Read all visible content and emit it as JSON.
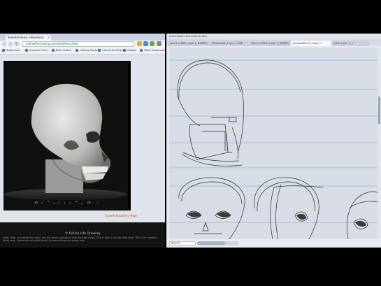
{
  "browser": {
    "tab_title": "Skeletal Head, eSkeletons",
    "address": "onlinelifedrawing.com/skull/skull.html",
    "bookmarks": [
      "Bookmarks",
      "Imported from...",
      "Most Visited",
      "Getting Started",
      "Latest Headlines",
      "Google",
      "Other bookmarks"
    ],
    "credit_link": "FaceAndAnatomy Page",
    "page_title": "© Online Life Drawing",
    "description": "Grab, drag, and rotate the skull. Use the arrow controls to step through views. This is free to use for reference. This is for personal study only, please do not redistribute. For educational purposes only."
  },
  "app": {
    "title": "sketchbook-skull-head-studies",
    "tabs": [
      "skull 1 (100%, Layer 1, RGB/8*)",
      "Sketchbook, Layer 1, RGB",
      "head 2 (100%, Layer 1, RGB/8*)",
      "skull-profile-14, Layer 1",
      "(50%, Layer 1...)"
    ],
    "active_tab_index": 3,
    "zoom": "66.67%"
  },
  "colors": {
    "guide_blue": "#8fb4dc",
    "credit_red": "#d24a3a",
    "canvas_bg": "#d8dde5"
  }
}
